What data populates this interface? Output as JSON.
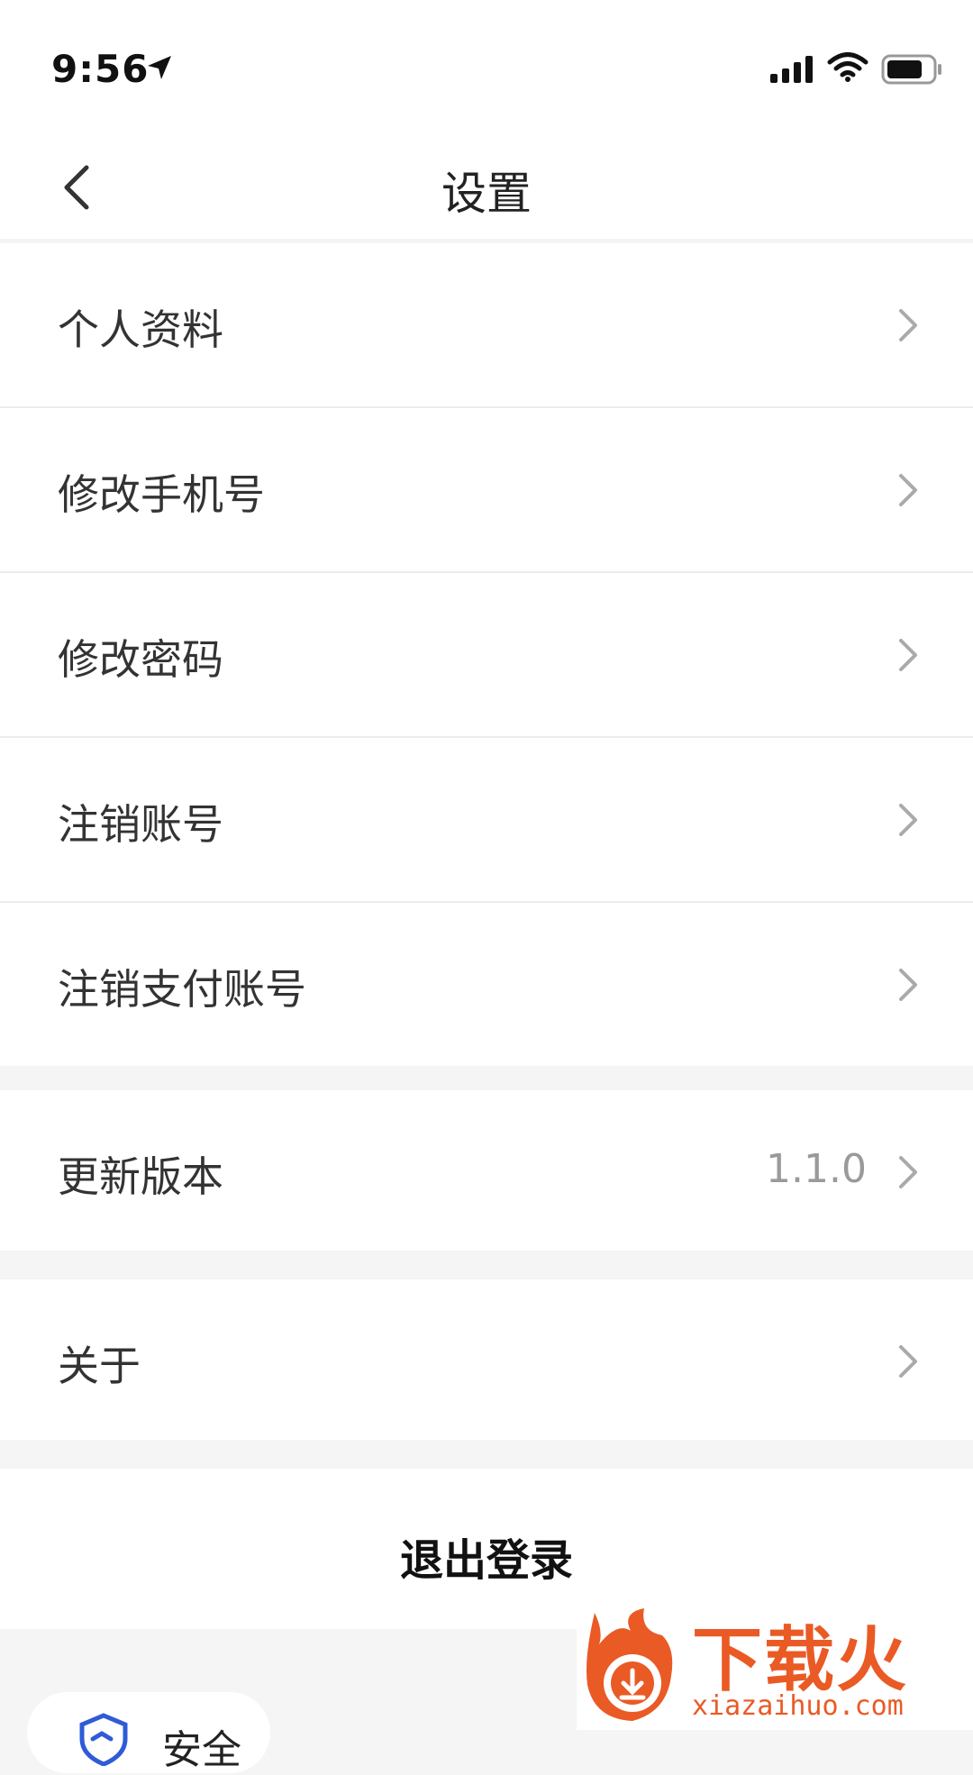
{
  "status_bar": {
    "time": "9:56"
  },
  "nav": {
    "title": "设置"
  },
  "groups": [
    {
      "items": [
        {
          "label": "个人资料"
        },
        {
          "label": "修改手机号"
        },
        {
          "label": "修改密码"
        },
        {
          "label": "注销账号"
        },
        {
          "label": "注销支付账号"
        }
      ]
    },
    {
      "items": [
        {
          "label": "更新版本",
          "value": "1.1.0"
        }
      ]
    },
    {
      "items": [
        {
          "label": "关于"
        }
      ]
    }
  ],
  "logout": {
    "label": "退出登录"
  },
  "bottom_pill": {
    "label": "安全"
  },
  "watermark": {
    "brand": "下载火",
    "url": "xiazaihuo.com"
  },
  "colors": {
    "accent": "#ea5a25",
    "shield": "#2f5bd8",
    "divider": "#ececec",
    "background": "#f5f5f5"
  }
}
